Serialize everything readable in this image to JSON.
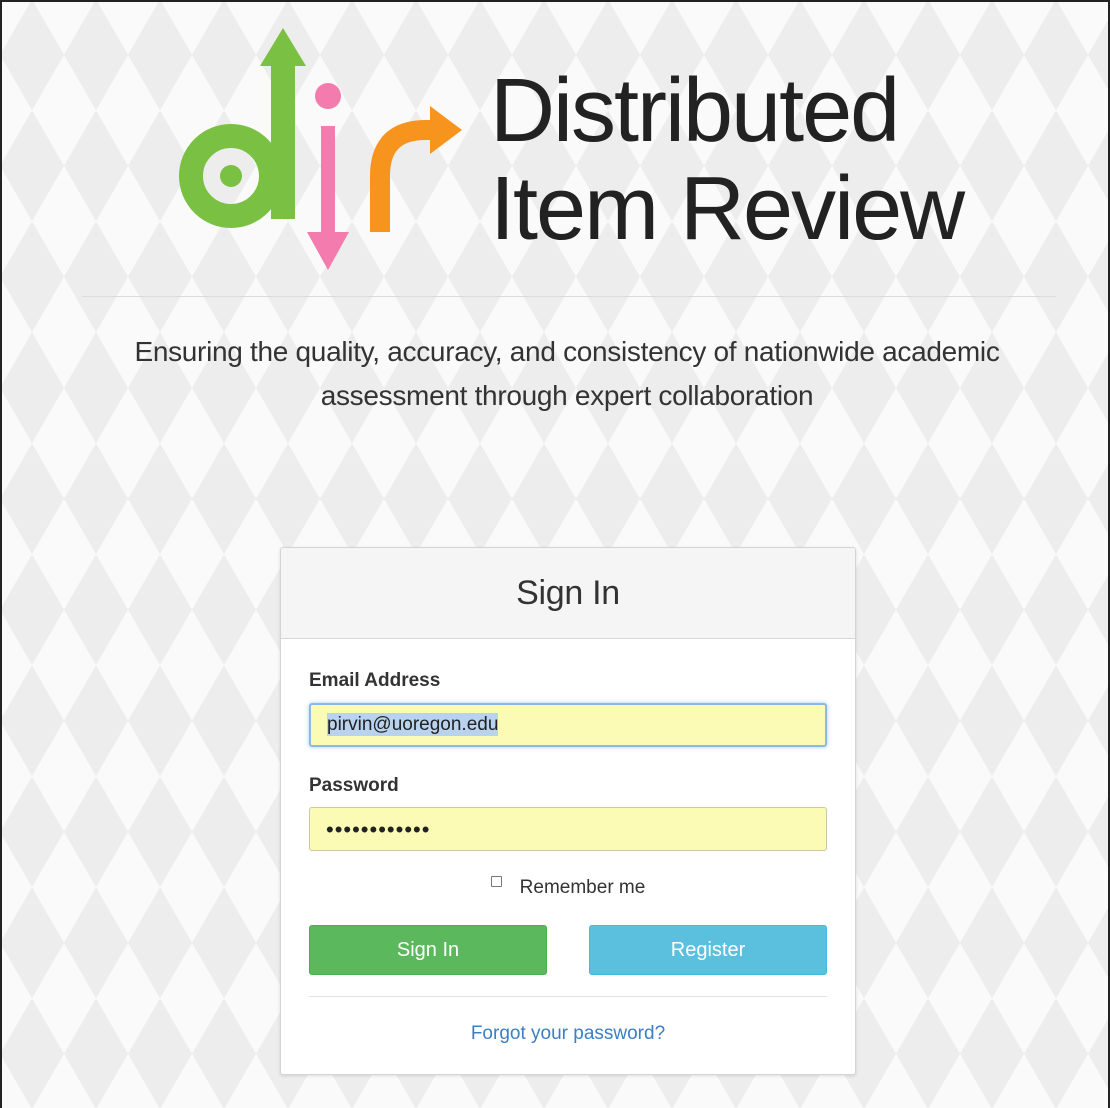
{
  "header": {
    "title_line1": "Distributed",
    "title_line2": "Item Review",
    "tagline_line1": "Ensuring the quality, accuracy, and consistency of nationwide academic",
    "tagline_line2": "assessment through expert collaboration"
  },
  "logo": {
    "letters": "dir",
    "colors": {
      "green": "#7ac143",
      "pink": "#f47bae",
      "orange": "#f7941d"
    }
  },
  "signin_panel": {
    "title": "Sign In",
    "email_label": "Email Address",
    "email_value": "pirvin@uoregon.edu",
    "password_label": "Password",
    "password_value": "••••••••••••",
    "remember_label": "Remember me",
    "remember_checked": false,
    "signin_button": "Sign In",
    "register_button": "Register",
    "forgot_link": "Forgot your password?"
  },
  "colors": {
    "signin_button": "#5cb85c",
    "register_button": "#5bc0de",
    "link": "#3b7fc4",
    "autofill_background": "#fbfbb6"
  }
}
